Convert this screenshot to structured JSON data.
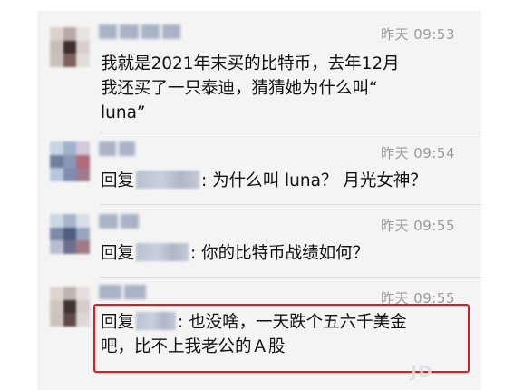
{
  "messages": [
    {
      "time": "昨天 09:53",
      "lines": [
        "我就是2021年末买的比特币，去年12月",
        "我还买了一只泰迪，猜猜她为什么叫“",
        "luna”"
      ]
    },
    {
      "time": "昨天 09:54",
      "reply_prefix": "回复",
      "reply_text": ": 为什么叫 luna？ 月光女神？"
    },
    {
      "time": "昨天 09:55",
      "reply_prefix": "回复",
      "reply_text": ": 你的比特币战绩如何？"
    },
    {
      "time": "昨天 09:55",
      "reply_prefix": "回复",
      "reply_text": ": 也没啥，一天跌个五六千美金",
      "line2": "吧，比不上我老公的Ａ股"
    }
  ],
  "colors": {
    "background": "#f4f4f4",
    "highlight": "#e01a1a",
    "time": "#9a9a9a"
  }
}
